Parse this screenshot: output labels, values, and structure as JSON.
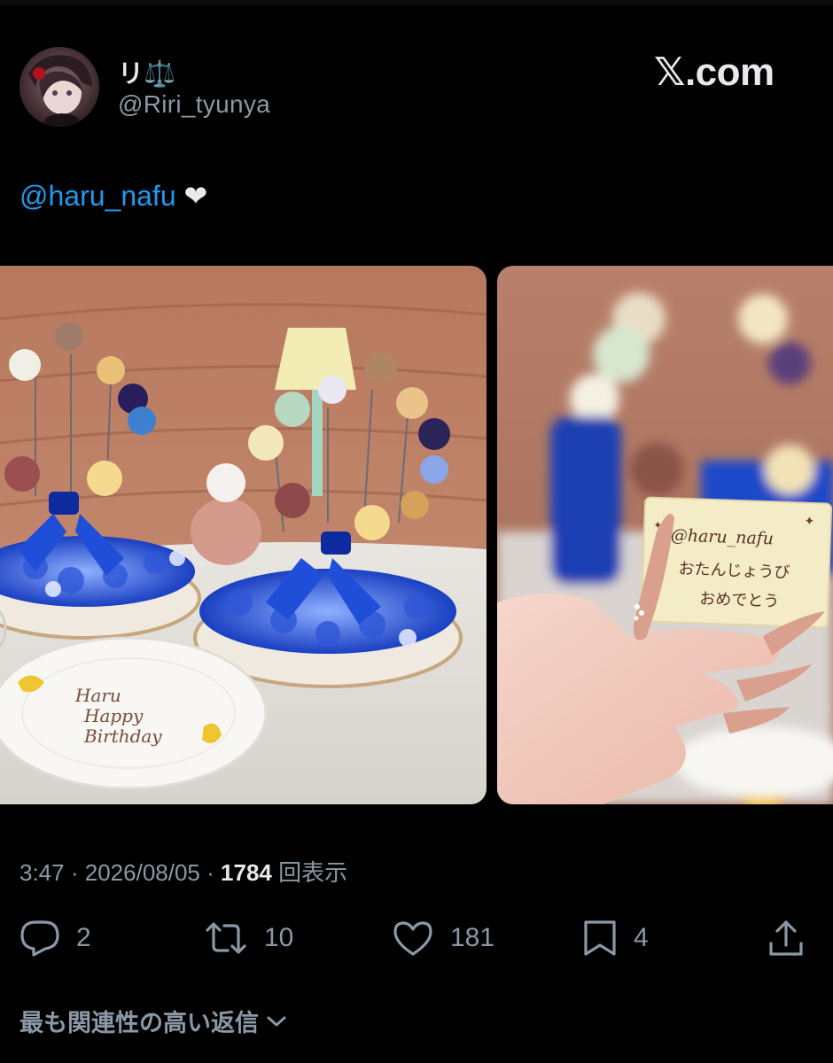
{
  "author": {
    "display_name": "リ⚖️",
    "handle": "@Riri_tyunya"
  },
  "brand": {
    "logo_text": "𝕏.com"
  },
  "tweet": {
    "mention": "@haru_nafu",
    "emoji": "❤"
  },
  "media": {
    "card_image": {
      "line1": "@haru_nafu",
      "line2": "おたんじょうび",
      "line3": "おめでとう"
    },
    "plate_image": {
      "line1": "Haru",
      "line2": "Happy",
      "line3": "Birthday"
    }
  },
  "meta": {
    "time": "3:47",
    "separator": "·",
    "date": "2026/08/05",
    "views_count": "1784",
    "views_label": "回表示"
  },
  "actions": {
    "replies": "2",
    "reposts": "10",
    "likes": "181",
    "bookmarks": "4"
  },
  "replies_section": {
    "label": "最も関連性の高い返信"
  },
  "colors": {
    "accent": "#1d9bf0",
    "muted": "#8b98a5",
    "background": "#000000"
  },
  "icons": [
    "reply-icon",
    "repost-icon",
    "like-icon",
    "bookmark-icon",
    "share-icon",
    "chevron-down-icon"
  ]
}
